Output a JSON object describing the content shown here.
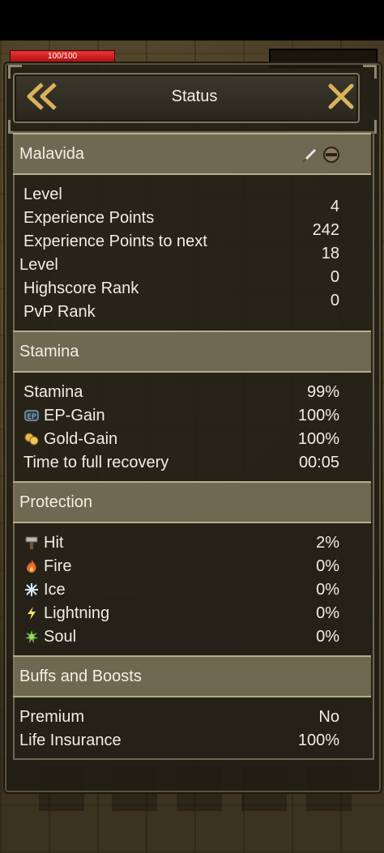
{
  "hud": {
    "health_text": "100/100"
  },
  "dialog": {
    "title": "Status"
  },
  "character": {
    "name": "Malavida",
    "icons": [
      "sword-icon",
      "helmet-icon"
    ]
  },
  "stats": {
    "level_label": "Level",
    "level_value": "4",
    "exp_label": "Experience Points",
    "exp_value": "242",
    "exp_next_label_1": "Experience Points to next",
    "exp_next_label_2": "Level",
    "exp_next_value": "18",
    "highscore_label": "Highscore Rank",
    "highscore_value": "0",
    "pvp_label": "PvP Rank",
    "pvp_value": "0"
  },
  "stamina": {
    "header": "Stamina",
    "stamina_label": "Stamina",
    "stamina_value": "99%",
    "ep_label": "EP-Gain",
    "ep_value": "100%",
    "gold_label": "Gold-Gain",
    "gold_value": "100%",
    "recovery_label": "Time to full recovery",
    "recovery_value": "00:05"
  },
  "protection": {
    "header": "Protection",
    "hit_label": "Hit",
    "hit_value": "2%",
    "fire_label": "Fire",
    "fire_value": "0%",
    "ice_label": "Ice",
    "ice_value": "0%",
    "lightning_label": "Lightning",
    "lightning_value": "0%",
    "soul_label": "Soul",
    "soul_value": "0%"
  },
  "buffs": {
    "header": "Buffs and Boosts",
    "premium_label": "Premium",
    "premium_value": "No",
    "insurance_label": "Life Insurance",
    "insurance_value": "100%"
  },
  "colors": {
    "section_header_bg": "#827a60",
    "panel_border": "#6e6650",
    "health_bar": "#dd2222"
  }
}
